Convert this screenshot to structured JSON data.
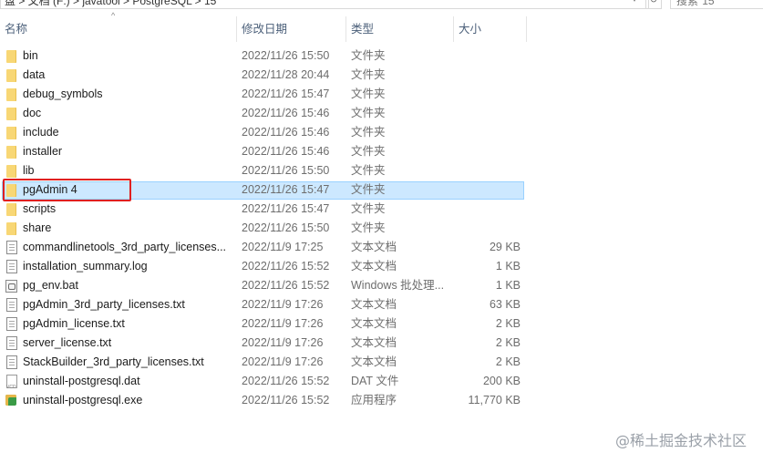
{
  "address": {
    "path": "盘 > 文档 (F:) > javatool > PostgreSQL > 15",
    "search_placeholder": "搜索\"15\""
  },
  "columns": {
    "name": "名称",
    "date": "修改日期",
    "type": "类型",
    "size": "大小"
  },
  "files": [
    {
      "name": "bin",
      "date": "2022/11/26 15:50",
      "type": "文件夹",
      "size": "",
      "icon": "folder-icon"
    },
    {
      "name": "data",
      "date": "2022/11/28 20:44",
      "type": "文件夹",
      "size": "",
      "icon": "folder-icon"
    },
    {
      "name": "debug_symbols",
      "date": "2022/11/26 15:47",
      "type": "文件夹",
      "size": "",
      "icon": "folder-icon"
    },
    {
      "name": "doc",
      "date": "2022/11/26 15:46",
      "type": "文件夹",
      "size": "",
      "icon": "folder-icon"
    },
    {
      "name": "include",
      "date": "2022/11/26 15:46",
      "type": "文件夹",
      "size": "",
      "icon": "folder-icon"
    },
    {
      "name": "installer",
      "date": "2022/11/26 15:46",
      "type": "文件夹",
      "size": "",
      "icon": "folder-icon"
    },
    {
      "name": "lib",
      "date": "2022/11/26 15:50",
      "type": "文件夹",
      "size": "",
      "icon": "folder-icon"
    },
    {
      "name": "pgAdmin 4",
      "date": "2022/11/26 15:47",
      "type": "文件夹",
      "size": "",
      "icon": "folder-icon",
      "selected": true
    },
    {
      "name": "scripts",
      "date": "2022/11/26 15:47",
      "type": "文件夹",
      "size": "",
      "icon": "folder-icon"
    },
    {
      "name": "share",
      "date": "2022/11/26 15:50",
      "type": "文件夹",
      "size": "",
      "icon": "folder-icon"
    },
    {
      "name": "commandlinetools_3rd_party_licenses...",
      "date": "2022/11/9 17:25",
      "type": "文本文档",
      "size": "29 KB",
      "icon": "text-file-icon"
    },
    {
      "name": "installation_summary.log",
      "date": "2022/11/26 15:52",
      "type": "文本文档",
      "size": "1 KB",
      "icon": "text-file-icon"
    },
    {
      "name": "pg_env.bat",
      "date": "2022/11/26 15:52",
      "type": "Windows 批处理...",
      "size": "1 KB",
      "icon": "batch-file-icon"
    },
    {
      "name": "pgAdmin_3rd_party_licenses.txt",
      "date": "2022/11/9 17:26",
      "type": "文本文档",
      "size": "63 KB",
      "icon": "text-file-icon"
    },
    {
      "name": "pgAdmin_license.txt",
      "date": "2022/11/9 17:26",
      "type": "文本文档",
      "size": "2 KB",
      "icon": "text-file-icon"
    },
    {
      "name": "server_license.txt",
      "date": "2022/11/9 17:26",
      "type": "文本文档",
      "size": "2 KB",
      "icon": "text-file-icon"
    },
    {
      "name": "StackBuilder_3rd_party_licenses.txt",
      "date": "2022/11/9 17:26",
      "type": "文本文档",
      "size": "2 KB",
      "icon": "text-file-icon"
    },
    {
      "name": "uninstall-postgresql.dat",
      "date": "2022/11/26 15:52",
      "type": "DAT 文件",
      "size": "200 KB",
      "icon": "dat-file-icon"
    },
    {
      "name": "uninstall-postgresql.exe",
      "date": "2022/11/26 15:52",
      "type": "应用程序",
      "size": "11,770 KB",
      "icon": "exe-file-icon"
    }
  ],
  "watermark": "@稀土掘金技术社区",
  "colors": {
    "selection_bg": "#cce8ff",
    "selection_border": "#99d1ff",
    "highlight_box": "#e02020",
    "folder": "#f8d775",
    "header_text": "#4c607a"
  }
}
